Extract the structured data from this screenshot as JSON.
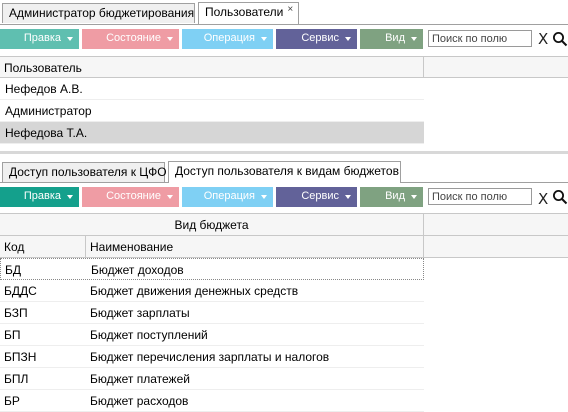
{
  "top_tabs": [
    {
      "label": "Администратор бюджетирования",
      "active": false
    },
    {
      "label": "Пользователи",
      "active": true,
      "close": "×"
    }
  ],
  "toolbar": {
    "pravka": "Правка",
    "sostoyanie": "Состояние",
    "operatsiya": "Операция",
    "servis": "Сервис",
    "vid": "Вид",
    "search_placeholder": "Поиск по полю",
    "clear": "X"
  },
  "users_grid": {
    "header": "Пользователь",
    "rows": [
      "Нефедов А.В.",
      "Администратор",
      "Нефедова Т.А."
    ],
    "selected_index": 2
  },
  "bottom_tabs": [
    {
      "label": "Доступ пользователя к ЦФО",
      "active": false
    },
    {
      "label": "Доступ пользователя к видам бюджетов",
      "active": true
    }
  ],
  "budget_grid": {
    "group_header": "Вид бюджета",
    "col_code": "Код",
    "col_name": "Наименование",
    "rows": [
      {
        "code": "БД",
        "name": "Бюджет доходов"
      },
      {
        "code": "БДДС",
        "name": "Бюджет движения денежных средств"
      },
      {
        "code": "БЗП",
        "name": "Бюджет зарплаты"
      },
      {
        "code": "БП",
        "name": "Бюджет поступлений"
      },
      {
        "code": "БПЗН",
        "name": "Бюджет перечисления зарплаты и налогов"
      },
      {
        "code": "БПЛ",
        "name": "Бюджет платежей"
      },
      {
        "code": "БР",
        "name": "Бюджет расходов"
      }
    ]
  },
  "colors": {
    "pravka": "#14a08c",
    "sostoyanie": "#ef9ca4",
    "operatsiya": "#7fd0f4",
    "servis": "#626299",
    "vid": "#7fa281",
    "selected_row": "#d6d6d6"
  }
}
